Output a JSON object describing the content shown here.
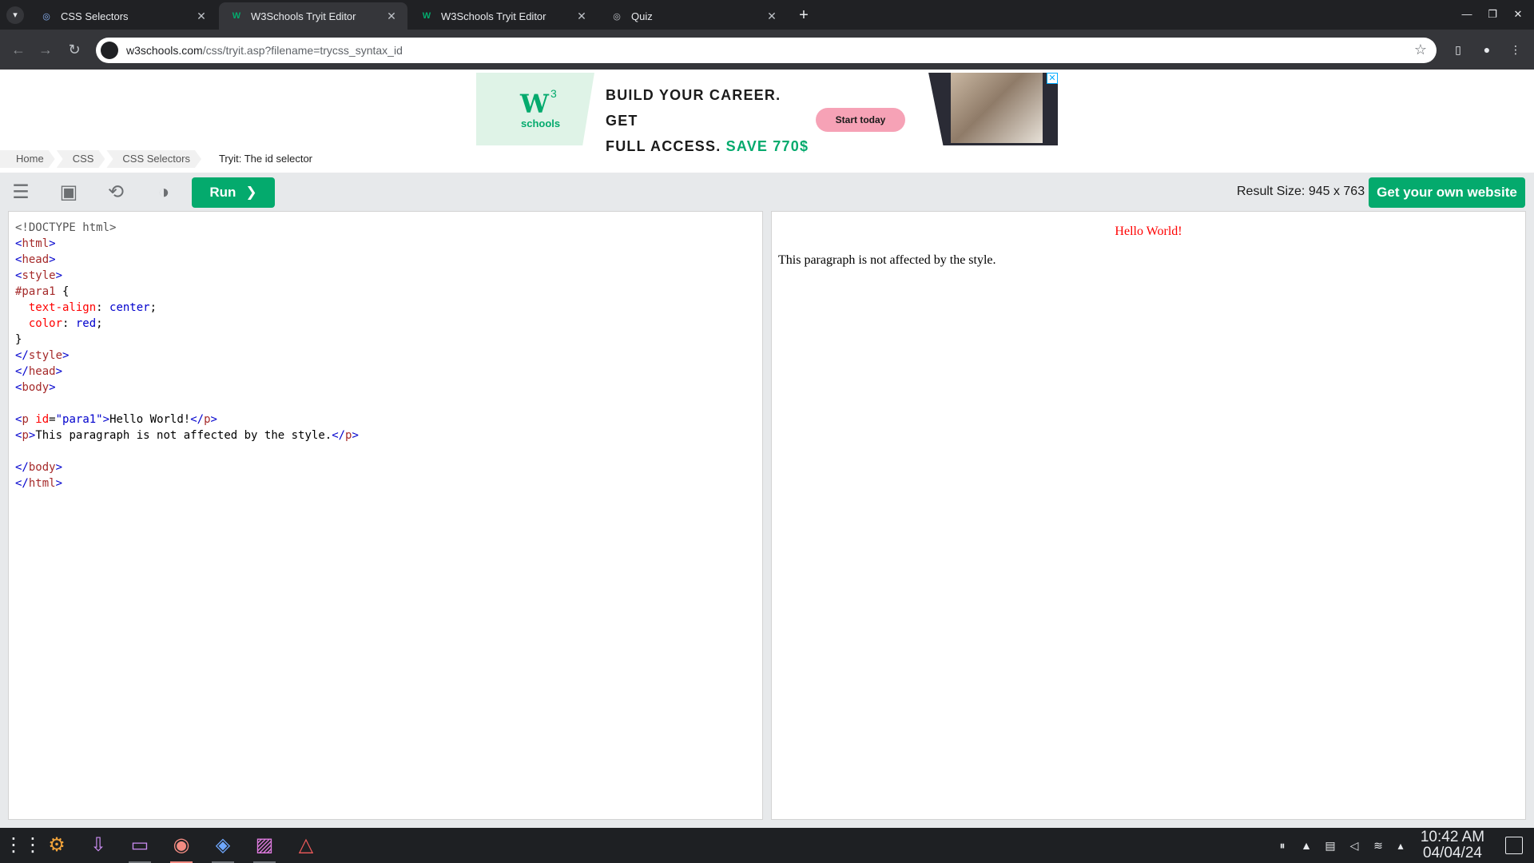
{
  "browser": {
    "tabs": [
      {
        "title": "CSS Selectors",
        "icon": "globe-icon"
      },
      {
        "title": "W3Schools Tryit Editor",
        "icon": "w3schools-icon"
      },
      {
        "title": "W3Schools Tryit Editor",
        "icon": "w3schools-icon"
      },
      {
        "title": "Quiz",
        "icon": "globe-icon"
      }
    ],
    "active_tab": 1,
    "url_host": "w3schools.com",
    "url_path": "/css/tryit.asp?filename=trycss_syntax_id"
  },
  "ad": {
    "logo_text": "W",
    "logo_sup": "3",
    "logo_sub": "schools",
    "headline_1": "BUILD YOUR CAREER. GET",
    "headline_2": "FULL ACCESS.",
    "headline_save": "SAVE 770$",
    "cta": "Start today",
    "close": "✕"
  },
  "breadcrumb": {
    "items": [
      "Home",
      "CSS",
      "CSS Selectors",
      "Tryit: The id selector"
    ]
  },
  "editor": {
    "run_label": "Run",
    "run_arrow": "❯",
    "result_size": "Result Size: 945 x 763",
    "own_website": "Get your own website"
  },
  "code": {
    "lines": [
      [
        {
          "t": "<!DOCTYPE html>",
          "c": "doc"
        }
      ],
      [
        {
          "t": "<",
          "c": "br"
        },
        {
          "t": "html",
          "c": "tag"
        },
        {
          "t": ">",
          "c": "br"
        }
      ],
      [
        {
          "t": "<",
          "c": "br"
        },
        {
          "t": "head",
          "c": "tag"
        },
        {
          "t": ">",
          "c": "br"
        }
      ],
      [
        {
          "t": "<",
          "c": "br"
        },
        {
          "t": "style",
          "c": "tag"
        },
        {
          "t": ">",
          "c": "br"
        }
      ],
      [
        {
          "t": "#para1",
          "c": "sel"
        },
        {
          "t": " {",
          "c": "plain"
        }
      ],
      [
        {
          "t": "  text-align",
          "c": "prop"
        },
        {
          "t": ": ",
          "c": "plain"
        },
        {
          "t": "center",
          "c": "pval"
        },
        {
          "t": ";",
          "c": "plain"
        }
      ],
      [
        {
          "t": "  color",
          "c": "prop"
        },
        {
          "t": ": ",
          "c": "plain"
        },
        {
          "t": "red",
          "c": "pval"
        },
        {
          "t": ";",
          "c": "plain"
        }
      ],
      [
        {
          "t": "}",
          "c": "plain"
        }
      ],
      [
        {
          "t": "</",
          "c": "br"
        },
        {
          "t": "style",
          "c": "tag"
        },
        {
          "t": ">",
          "c": "br"
        }
      ],
      [
        {
          "t": "</",
          "c": "br"
        },
        {
          "t": "head",
          "c": "tag"
        },
        {
          "t": ">",
          "c": "br"
        }
      ],
      [
        {
          "t": "<",
          "c": "br"
        },
        {
          "t": "body",
          "c": "tag"
        },
        {
          "t": ">",
          "c": "br"
        }
      ],
      [],
      [
        {
          "t": "<",
          "c": "br"
        },
        {
          "t": "p",
          "c": "tag"
        },
        {
          "t": " id",
          "c": "attr"
        },
        {
          "t": "=",
          "c": "plain"
        },
        {
          "t": "\"para1\"",
          "c": "val"
        },
        {
          "t": ">",
          "c": "br"
        },
        {
          "t": "Hello World!",
          "c": "plain"
        },
        {
          "t": "</",
          "c": "br"
        },
        {
          "t": "p",
          "c": "tag"
        },
        {
          "t": ">",
          "c": "br"
        }
      ],
      [
        {
          "t": "<",
          "c": "br"
        },
        {
          "t": "p",
          "c": "tag"
        },
        {
          "t": ">",
          "c": "br"
        },
        {
          "t": "This paragraph is not affected by the style.",
          "c": "plain"
        },
        {
          "t": "</",
          "c": "br"
        },
        {
          "t": "p",
          "c": "tag"
        },
        {
          "t": ">",
          "c": "br"
        }
      ],
      [],
      [
        {
          "t": "</",
          "c": "br"
        },
        {
          "t": "body",
          "c": "tag"
        },
        {
          "t": ">",
          "c": "br"
        }
      ],
      [
        {
          "t": "</",
          "c": "br"
        },
        {
          "t": "html",
          "c": "tag"
        },
        {
          "t": ">",
          "c": "br"
        }
      ]
    ]
  },
  "result": {
    "hello": "Hello World!",
    "paragraph": "This paragraph is not affected by the style."
  },
  "taskbar": {
    "apps": [
      "app-launcher-icon",
      "settings-icon",
      "software-center-icon",
      "file-manager-icon",
      "chrome-icon",
      "vscode-icon",
      "image-viewer-icon",
      "text-editor-icon"
    ],
    "time": "10:42 AM",
    "date": "04/04/24"
  },
  "colors": {
    "accent": "#04AA6D",
    "tab_bg": "#202124",
    "toolbar_bg": "#35363a"
  }
}
